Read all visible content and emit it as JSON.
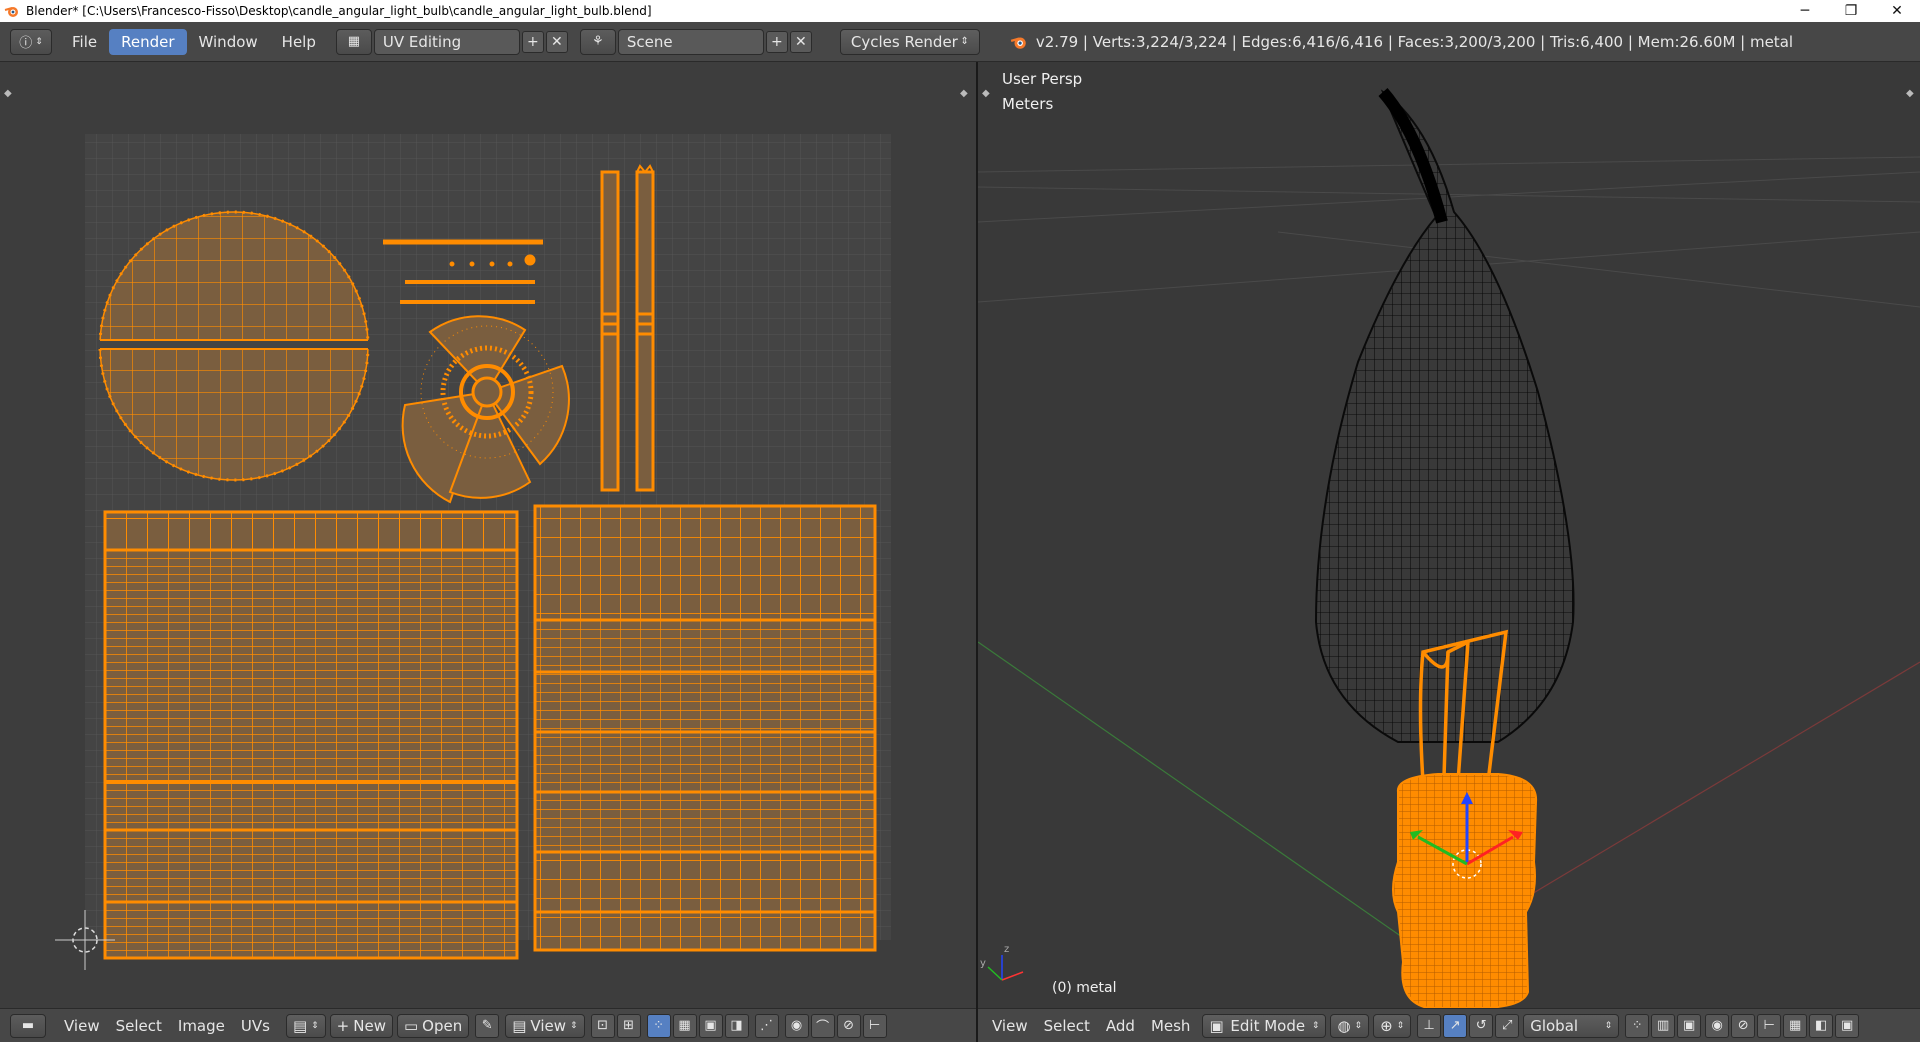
{
  "window": {
    "title": "Blender* [C:\\Users\\Francesco-Fisso\\Desktop\\candle_angular_light_bulb\\candle_angular_light_bulb.blend]",
    "minimize": "─",
    "restore": "❐",
    "close": "✕"
  },
  "info_header": {
    "menus": [
      {
        "label": "File",
        "active": false
      },
      {
        "label": "Render",
        "active": true
      },
      {
        "label": "Window",
        "active": false
      },
      {
        "label": "Help",
        "active": false
      }
    ],
    "screen_layout": "UV Editing",
    "scene": "Scene",
    "render_engine": "Cycles Render",
    "stats": "v2.79 | Verts:3,224/3,224 | Edges:6,416/6,416 | Faces:3,200/3,200 | Tris:6,400 | Mem:26.60M | metal"
  },
  "viewport": {
    "view_name": "User Persp",
    "units": "Meters",
    "object_label": "(0) metal"
  },
  "uv_footer": {
    "menus": [
      "View",
      "Select",
      "Image",
      "UVs"
    ],
    "new_label": "New",
    "open_label": "Open",
    "view_label": "View"
  },
  "view3d_footer": {
    "menus": [
      "View",
      "Select",
      "Add",
      "Mesh"
    ],
    "mode": "Edit Mode",
    "orientation": "Global"
  },
  "colors": {
    "uv_orange": "#ff8c00",
    "face_fill": "#7a5e3f",
    "accent_blue": "#5680c2",
    "background": "#3d3d3d"
  }
}
